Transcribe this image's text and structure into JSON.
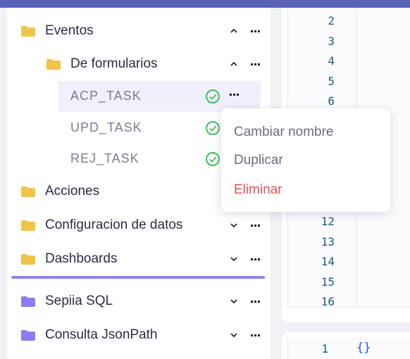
{
  "colors": {
    "accent": "#5a5fb8",
    "folder_yellow": "#f1c347",
    "folder_purple": "#8b7cf6",
    "success_green": "#3cbf5a",
    "danger_red": "#e8505b",
    "line_number": "#1d5d7a"
  },
  "sidebar": {
    "items": [
      {
        "label": "Eventos",
        "icon": "folder-icon",
        "expanded": true
      },
      {
        "label": "De formularios",
        "icon": "folder-icon",
        "expanded": true
      },
      {
        "label": "Acciones",
        "icon": "folder-icon"
      },
      {
        "label": "Configuracion de datos",
        "icon": "folder-icon",
        "expanded": false
      },
      {
        "label": "Dashboards",
        "icon": "folder-icon",
        "expanded": false
      },
      {
        "label": "Sepiia SQL",
        "icon": "folder-icon",
        "expanded": false
      },
      {
        "label": "Consulta JsonPath",
        "icon": "folder-icon",
        "expanded": false
      }
    ],
    "tasks": [
      {
        "label": "ACP_TASK",
        "status": "check-circle-icon",
        "selected": true
      },
      {
        "label": "UPD_TASK",
        "status": "check-circle-icon"
      },
      {
        "label": "REJ_TASK",
        "status": "check-circle-icon"
      }
    ]
  },
  "context_menu": {
    "rename": "Cambiar nombre",
    "duplicate": "Duplicar",
    "delete": "Eliminar"
  },
  "editor": {
    "line_numbers": [
      "2",
      "3",
      "4",
      "5",
      "6",
      "12",
      "13",
      "14",
      "15",
      "16"
    ],
    "second_line_number": "1",
    "second_content": "{}"
  }
}
